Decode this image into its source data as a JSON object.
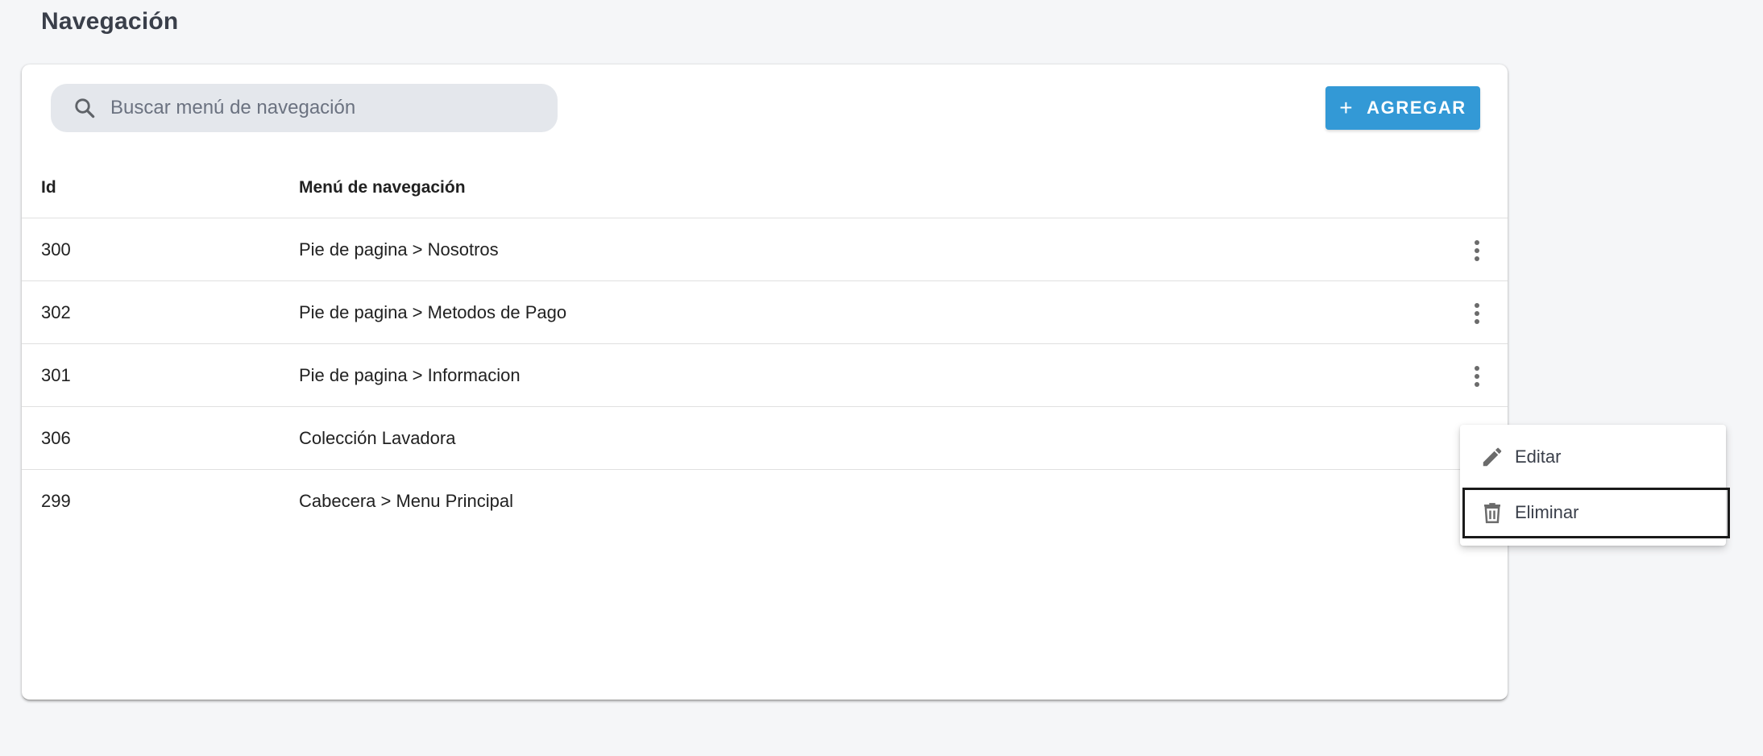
{
  "page": {
    "title": "Navegación"
  },
  "search": {
    "placeholder": "Buscar menú de navegación",
    "value": "",
    "icon": "search-icon"
  },
  "toolbar": {
    "add_label": "AGREGAR",
    "add_icon": "+",
    "accent_color": "#3399d6"
  },
  "table": {
    "columns": [
      "Id",
      "Menú de navegación"
    ],
    "rows": [
      {
        "id": "300",
        "menu": "Pie de pagina > Nosotros"
      },
      {
        "id": "302",
        "menu": "Pie de pagina > Metodos de Pago"
      },
      {
        "id": "301",
        "menu": "Pie de pagina > Informacion"
      },
      {
        "id": "306",
        "menu": "Colección Lavadora"
      },
      {
        "id": "299",
        "menu": "Cabecera > Menu Principal"
      }
    ]
  },
  "context_menu": {
    "items": [
      {
        "label": "Editar",
        "icon": "pencil-icon"
      },
      {
        "label": "Eliminar",
        "icon": "trash-icon"
      }
    ]
  }
}
